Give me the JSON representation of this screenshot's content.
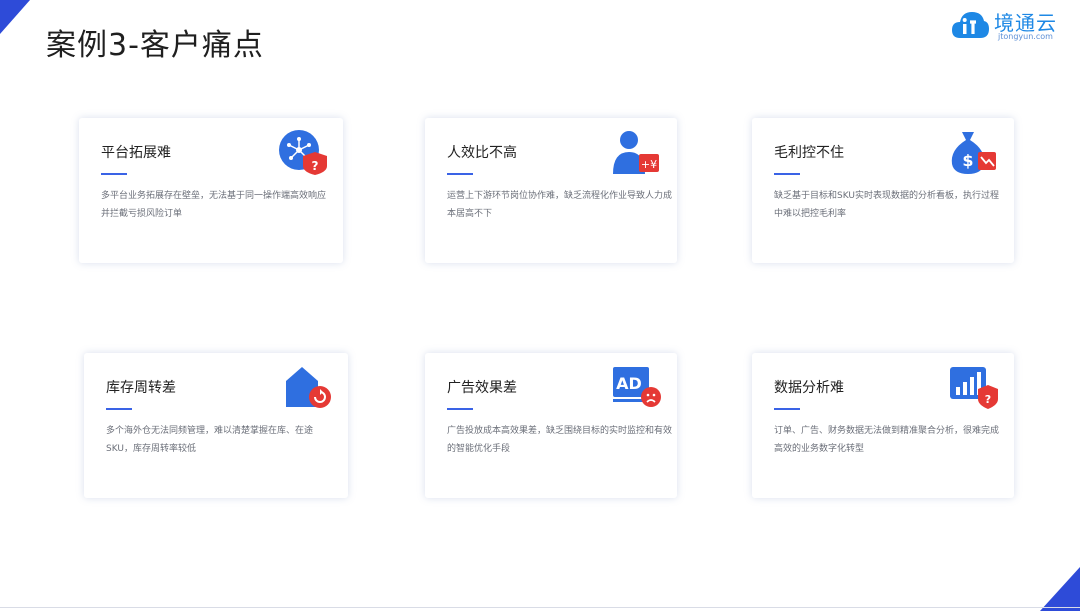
{
  "slide": {
    "title": "案例3-客户痛点"
  },
  "logo": {
    "name": "境通云",
    "url": "jtongyun.com"
  },
  "colors": {
    "accent_blue": "#3a63e6",
    "warning_red": "#e53935",
    "corner_blue": "#2e4bd8"
  },
  "cards": [
    {
      "title": "平台拓展难",
      "desc": "多平台业务拓展存在壁垒，无法基于同一操作端高效响应并拦截亏损风险订单",
      "icon": "platform-network-warning-icon"
    },
    {
      "title": "人效比不高",
      "desc": "运营上下游环节岗位协作难，缺乏流程化作业导致人力成本居高不下",
      "icon": "person-cost-icon"
    },
    {
      "title": "毛利控不住",
      "desc": "缺乏基于目标和SKU实时表现数据的分析看板，执行过程中难以把控毛利率",
      "icon": "money-bag-decline-icon"
    },
    {
      "title": "库存周转差",
      "desc": "多个海外仓无法同频管理，难以清楚掌握在库、在途SKU，库存周转率较低",
      "icon": "warehouse-turnover-icon"
    },
    {
      "title": "广告效果差",
      "desc": "广告投放成本高效果差，缺乏围绕目标的实时监控和有效的智能优化手段",
      "icon": "ad-sad-icon"
    },
    {
      "title": "数据分析难",
      "desc": "订单、广告、财务数据无法做到精准聚合分析，很难完成高效的业务数字化转型",
      "icon": "bar-chart-warning-icon"
    }
  ]
}
